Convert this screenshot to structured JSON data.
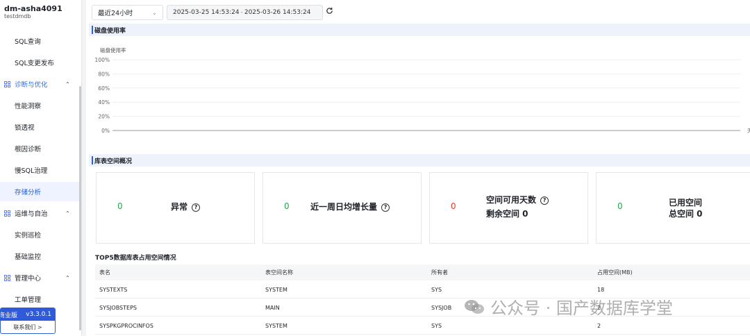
{
  "instance": {
    "name": "dm-asha4091",
    "db": "testdmdb"
  },
  "sidebar": {
    "items": [
      {
        "label": "SQL查询",
        "type": "item"
      },
      {
        "label": "SQL变更发布",
        "type": "item"
      },
      {
        "label": "诊断与优化",
        "type": "group",
        "icon": "grid-icon",
        "chevron": "⌃"
      },
      {
        "label": "性能洞察",
        "type": "item"
      },
      {
        "label": "锁透视",
        "type": "item"
      },
      {
        "label": "根因诊断",
        "type": "item"
      },
      {
        "label": "慢SQL治理",
        "type": "item"
      },
      {
        "label": "存储分析",
        "type": "item",
        "active": true
      },
      {
        "label": "运维与自治",
        "type": "group",
        "icon": "grid-icon",
        "chevron": "⌃"
      },
      {
        "label": "实例巡检",
        "type": "item"
      },
      {
        "label": "基础监控",
        "type": "item"
      },
      {
        "label": "管理中心",
        "type": "group",
        "icon": "grid-icon",
        "chevron": "⌃"
      },
      {
        "label": "工单管理",
        "type": "item"
      }
    ],
    "version": {
      "edition": "商业版",
      "number": "v3.3.0.1",
      "contact": "联系我们 >"
    }
  },
  "toolbar": {
    "time_select": "最近24小时",
    "range_start": "2025-03-25 14:53:24",
    "range_sep": "-",
    "range_end": "2025-03-26 14:53:24"
  },
  "disk_section": {
    "title": "磁盘使用率"
  },
  "chart_data": {
    "type": "line",
    "title": "磁盘使用率",
    "ylim": [
      0,
      100
    ],
    "y_ticks": [
      "100%",
      "80%",
      "60%",
      "40%",
      "20%",
      "0%"
    ],
    "series": [],
    "edge_label": "无"
  },
  "space_section": {
    "title": "库表空间概况"
  },
  "cards": [
    {
      "value": "0",
      "value_color": "#2ea44f",
      "label1": "异常",
      "help": "?"
    },
    {
      "value": "0",
      "value_color": "#2ea44f",
      "label1": "近一周日均增长量",
      "help": "?"
    },
    {
      "value": "0",
      "value_color": "#e03e2d",
      "label1": "空间可用天数",
      "help": "?",
      "label2": "剩余空间 0"
    },
    {
      "value": "0",
      "value_color": "#2ea44f",
      "label1": "已用空间",
      "label2": "总空间 0"
    }
  ],
  "top5": {
    "title": "TOP5数据库表占用空间情况",
    "columns": [
      "表名",
      "表空间名称",
      "所有者",
      "占用空间(MB)"
    ],
    "rows": [
      [
        "SYSTEXTS",
        "SYSTEM",
        "SYS",
        "18"
      ],
      [
        "SYSJOBSTEPS",
        "MAIN",
        "SYSJOB",
        "2"
      ],
      [
        "SYSPKGPROCINFOS",
        "SYSTEM",
        "SYS",
        "2"
      ]
    ]
  },
  "watermark": {
    "text": "公众号 · 国产数据库学堂"
  }
}
